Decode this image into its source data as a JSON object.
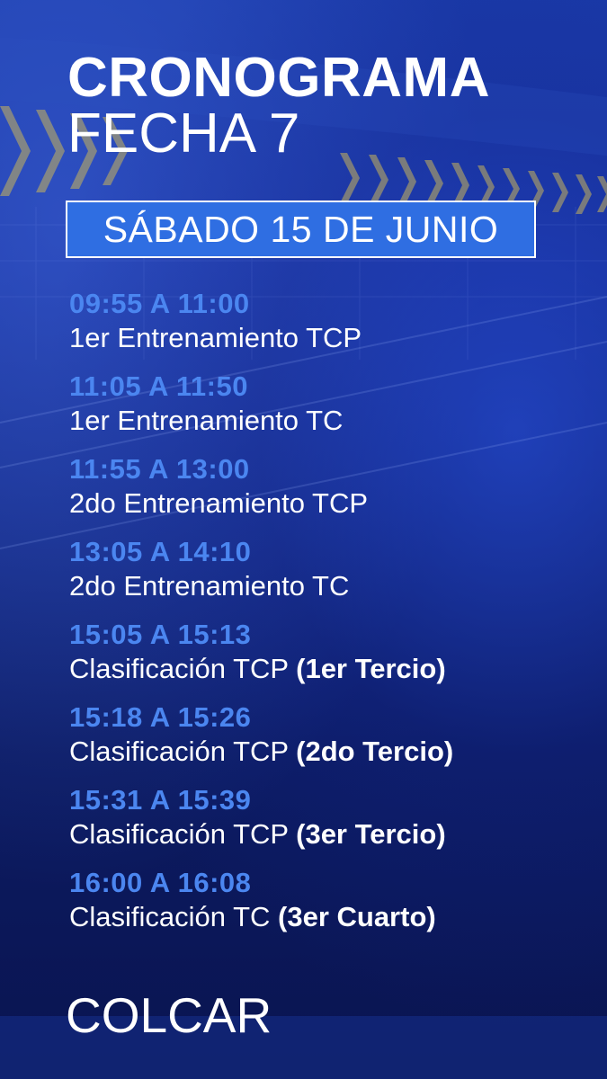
{
  "header": {
    "title": "CRONOGRAMA",
    "subtitle": "FECHA 7"
  },
  "date_banner": "SÁBADO 15 DE JUNIO",
  "schedule": [
    {
      "time": "09:55 A 11:00",
      "event": "1er Entrenamiento TCP",
      "note": ""
    },
    {
      "time": "11:05 A 11:50",
      "event": "1er Entrenamiento TC",
      "note": ""
    },
    {
      "time": "11:55 A 13:00",
      "event": "2do Entrenamiento TCP",
      "note": ""
    },
    {
      "time": "13:05 A 14:10",
      "event": "2do Entrenamiento TC",
      "note": ""
    },
    {
      "time": "15:05 A 15:13",
      "event": "Clasificación TCP ",
      "note": "(1er Tercio)"
    },
    {
      "time": "15:18 A 15:26",
      "event": "Clasificación TCP ",
      "note": "(2do Tercio)"
    },
    {
      "time": "15:31 A 15:39",
      "event": "Clasificación TCP ",
      "note": "(3er Tercio)"
    },
    {
      "time": "16:00 A 16:08",
      "event": "Clasificación TC ",
      "note": "(3er Cuarto)"
    }
  ],
  "footer": {
    "logo_text": "COLCAR"
  },
  "colors": {
    "time_text": "#4b86f0",
    "banner_fill": "#2f6ee2",
    "background": "#142a88"
  }
}
